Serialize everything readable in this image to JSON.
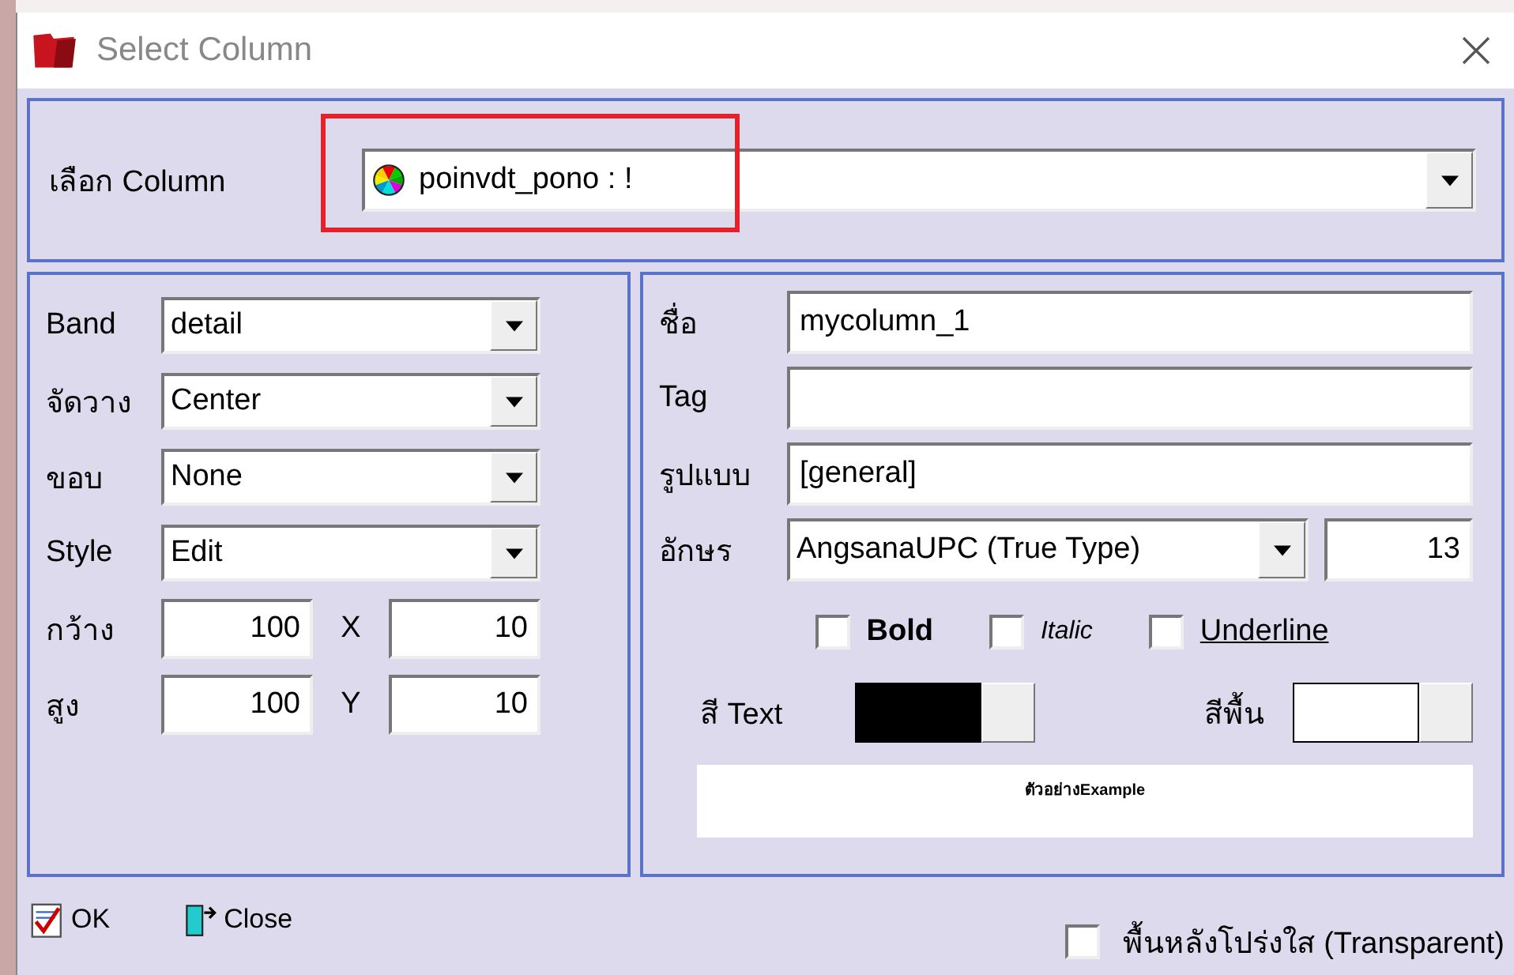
{
  "window": {
    "title": "Select Column"
  },
  "column_select": {
    "label": "เลือก Column",
    "value": "poinvdt_pono : !"
  },
  "left_fields": [
    {
      "kind": "combo",
      "label": "Band",
      "value": "detail"
    },
    {
      "kind": "combo",
      "label": "จัดวาง",
      "value": "Center"
    },
    {
      "kind": "combo",
      "label": "ขอบ",
      "value": "None"
    },
    {
      "kind": "combo",
      "label": "Style",
      "value": "Edit"
    },
    {
      "kind": "pair",
      "label": "กว้าง",
      "value": "100",
      "label_2": "X",
      "value_2": "10"
    },
    {
      "kind": "pair",
      "label": "สูง",
      "value": "100",
      "label_2": "Y",
      "value_2": "10"
    }
  ],
  "right_fields": [
    {
      "kind": "text",
      "label": "ชื่อ",
      "value": "mycolumn_1"
    },
    {
      "kind": "text",
      "label": "Tag"
    },
    {
      "kind": "text",
      "label": "รูปแบบ",
      "value": "[general]"
    },
    {
      "kind": "font",
      "label": "อักษร",
      "value": "AngsanaUPC (True Type)",
      "size": "13"
    }
  ],
  "styles": [
    {
      "kind": "bold",
      "label": "Bold",
      "checked": false
    },
    {
      "kind": "italic",
      "label": "Italic",
      "checked": false
    },
    {
      "kind": "underline",
      "label": "Underline",
      "checked": false
    }
  ],
  "colors": [
    {
      "label": "สี Text",
      "color": "#000000"
    },
    {
      "label": "สีพื้น",
      "color": "#ffffff"
    }
  ],
  "preview": "ตัวอย่างExample",
  "buttons": [
    {
      "kind": "ok",
      "label": "OK"
    },
    {
      "kind": "close",
      "label": "Close"
    }
  ],
  "transparent": {
    "label": "พื้นหลังโปร่งใส (Transparent)",
    "checked": false
  }
}
